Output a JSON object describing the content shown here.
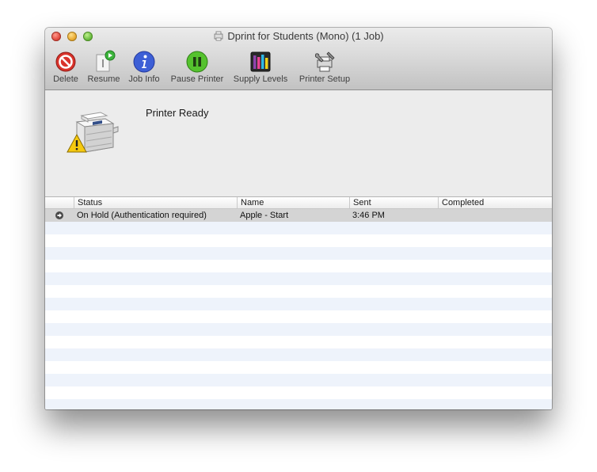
{
  "window": {
    "title": "Dprint for Students (Mono) (1 Job)"
  },
  "toolbar": {
    "items": [
      {
        "label": "Delete",
        "icon": "delete-icon"
      },
      {
        "label": "Resume",
        "icon": "resume-icon"
      },
      {
        "label": "Job Info",
        "icon": "info-icon"
      },
      {
        "label": "Pause Printer",
        "icon": "pause-icon"
      },
      {
        "label": "Supply Levels",
        "icon": "supply-levels-icon"
      },
      {
        "label": "Printer Setup",
        "icon": "printer-setup-icon"
      }
    ]
  },
  "status": {
    "text": "Printer Ready",
    "icon": "printer-warning-icon"
  },
  "table": {
    "columns": [
      "Status",
      "Name",
      "Sent",
      "Completed"
    ],
    "rows": [
      {
        "status": "On Hold (Authentication required)",
        "name": "Apple - Start",
        "sent": "3:46 PM",
        "completed": ""
      }
    ]
  },
  "colors": {
    "delete_red": "#d9332b",
    "resume_green": "#3cb43c",
    "info_blue": "#3d5fd6",
    "pause_green": "#55c22e"
  }
}
